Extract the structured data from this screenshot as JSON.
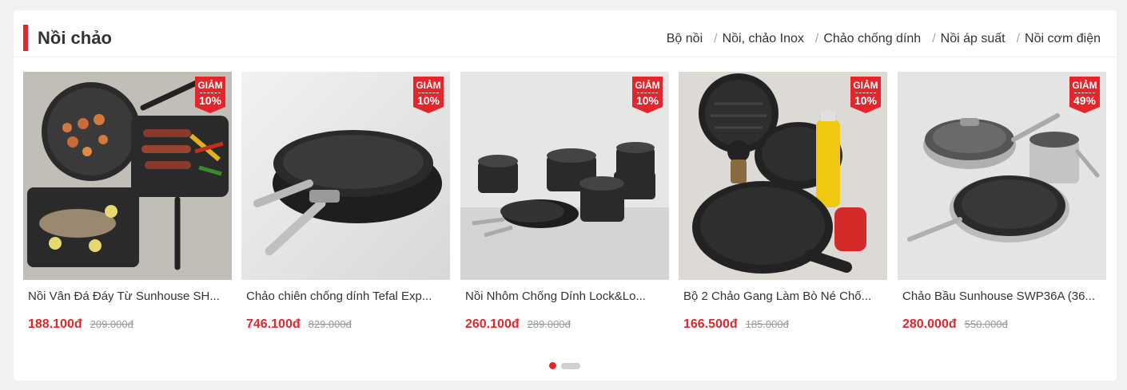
{
  "section": {
    "title": "Nồi chảo",
    "accent_color": "#e3262c",
    "categories": [
      "Bộ nồi",
      "Nồi, chảo Inox",
      "Chảo chống dính",
      "Nồi áp suất",
      "Nồi cơm điện"
    ],
    "separator": "/"
  },
  "products": [
    {
      "name": "Nồi Vân Đá Đáy Từ Sunhouse SH...",
      "price": "188.100đ",
      "old_price": "209.000đ",
      "badge_label": "GIẢM",
      "badge_value": "10%"
    },
    {
      "name": "Chảo chiên chống dính Tefal Exp...",
      "price": "746.100đ",
      "old_price": "829.000đ",
      "badge_label": "GIẢM",
      "badge_value": "10%"
    },
    {
      "name": "Nồi Nhôm Chống Dính Lock&Lo...",
      "price": "260.100đ",
      "old_price": "289.000đ",
      "badge_label": "GIẢM",
      "badge_value": "10%"
    },
    {
      "name": "Bộ 2 Chảo Gang Làm Bò Né Chố...",
      "price": "166.500đ",
      "old_price": "185.000đ",
      "badge_label": "GIẢM",
      "badge_value": "10%"
    },
    {
      "name": "Chảo Bầu Sunhouse SWP36A (36...",
      "price": "280.000đ",
      "old_price": "550.000đ",
      "badge_label": "GIẢM",
      "badge_value": "49%"
    }
  ],
  "pagination": {
    "pages": 2,
    "active": 1
  }
}
